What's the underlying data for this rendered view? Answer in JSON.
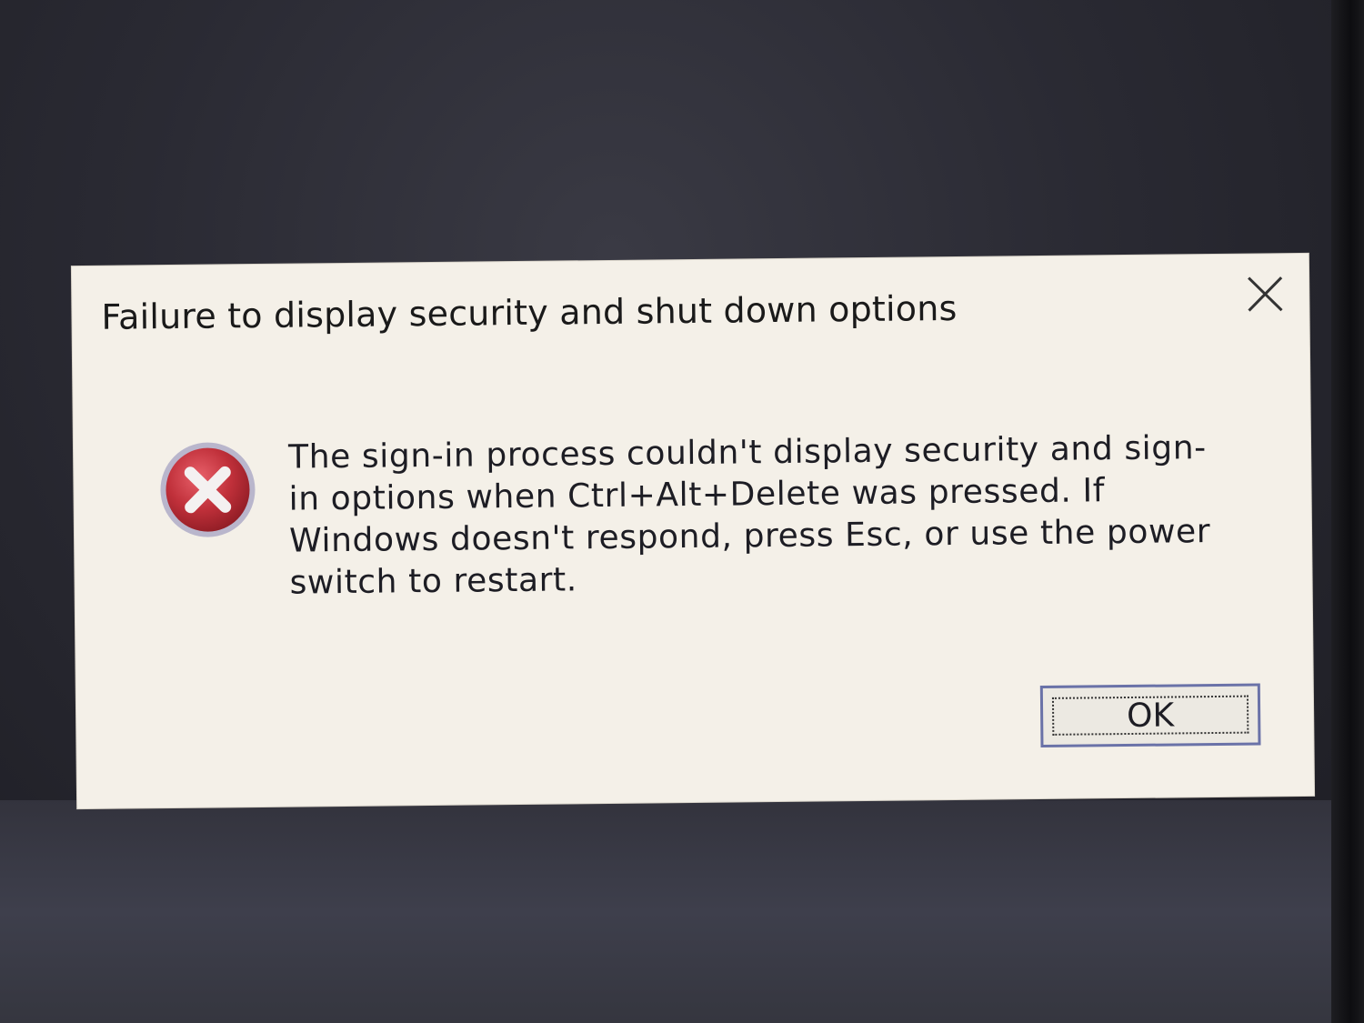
{
  "dialog": {
    "title": "Failure to display security and shut down options",
    "message": "The sign-in process couldn't display security and sign-in options when Ctrl+Alt+Delete was pressed. If Windows doesn't respond, press Esc, or use the power switch to restart.",
    "ok_label": "OK",
    "icons": {
      "close": "close-icon",
      "error": "error-icon"
    },
    "colors": {
      "background": "#f4f0e8",
      "error_red": "#c0303a",
      "button_border": "#6a72a8"
    }
  }
}
